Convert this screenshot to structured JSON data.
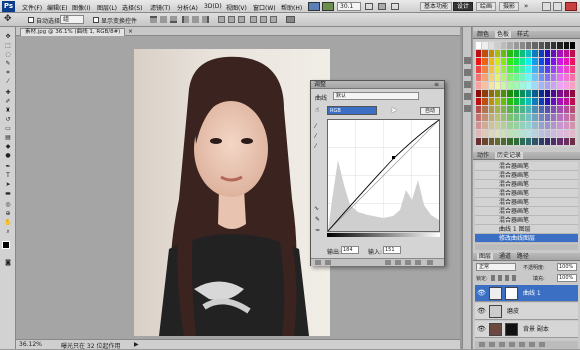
{
  "menubar": {
    "logo": "Ps",
    "items": [
      "文件(F)",
      "编辑(E)",
      "图像(I)",
      "图层(L)",
      "选择(S)",
      "滤镜(T)",
      "分析(A)",
      "3D(D)",
      "视图(V)",
      "窗口(W)",
      "帮助(H)"
    ],
    "zoom": "30.1",
    "workspaces": [
      "基本功能",
      "设计",
      "绘画",
      "摄影"
    ],
    "more": "»"
  },
  "options": {
    "auto_select_label": "自动选择:",
    "auto_select_value": "组",
    "show_transform": "显示变换控件"
  },
  "doc": {
    "tab": "素材.jpg @ 36.1% (曲线 1, RGB/8#)",
    "zoom_status": "36.12%",
    "status_text": "曝光只在 32 位起作用"
  },
  "curves": {
    "title": "调整",
    "preset_label": "曲线",
    "preset_value": "默认",
    "channel": "RGB",
    "auto": "自动",
    "output_label": "输出:",
    "output_value": "184",
    "input_label": "输入:",
    "input_value": "151"
  },
  "swatches": {
    "tabs": [
      "颜色",
      "色板",
      "样式"
    ]
  },
  "history": {
    "tabs": [
      "动作",
      "历史记录"
    ],
    "items": [
      "混合器画笔",
      "混合器画笔",
      "混合器画笔",
      "混合器画笔",
      "混合器画笔",
      "混合器画笔",
      "混合器画笔",
      "曲线 1 图层",
      "修改曲线图层"
    ]
  },
  "layers": {
    "tabs": [
      "图层",
      "通道",
      "路径"
    ],
    "mode": "正常",
    "opacity_label": "不透明度:",
    "opacity": "100%",
    "lock_label": "锁定:",
    "fill_label": "填充:",
    "fill": "100%",
    "items": [
      {
        "name": "曲线 1"
      },
      {
        "name": "磨皮"
      },
      {
        "name": "背景 副本"
      }
    ]
  },
  "colors": {
    "accent": "#3b6fc4",
    "ps_blue": "#0a3d8c"
  }
}
